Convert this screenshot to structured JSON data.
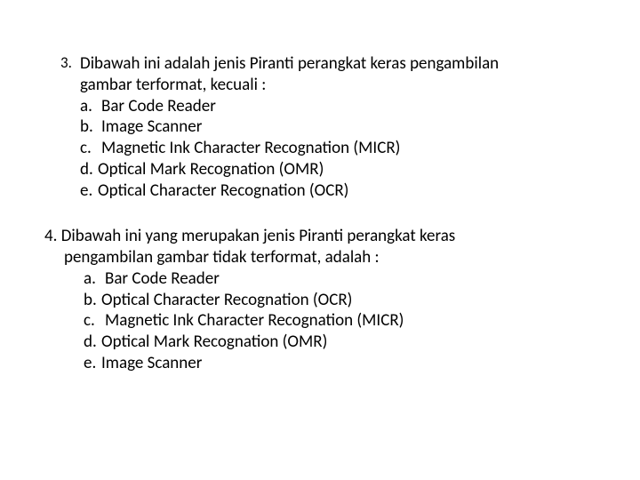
{
  "questions": [
    {
      "number": "3.",
      "text_line1": "Dibawah ini adalah jenis Piranti perangkat keras pengambilan",
      "text_line2": "gambar terformat, kecuali :",
      "options": [
        {
          "letter": "a.",
          "text": "Bar Code Reader",
          "tight": false
        },
        {
          "letter": "b.",
          "text": "Image Scanner",
          "tight": false
        },
        {
          "letter": "c.",
          "text": "Magnetic Ink Character Recognation (MICR)",
          "tight": false
        },
        {
          "letter": "d.",
          "text": "Optical Mark Recognation (OMR)",
          "tight": true
        },
        {
          "letter": "e.",
          "text": "Optical Character Recognation (OCR)",
          "tight": true
        }
      ]
    },
    {
      "number": "4.",
      "text_line1": "Dibawah ini yang merupakan jenis Piranti perangkat keras",
      "text_line2": "pengambilan gambar tidak terformat, adalah :",
      "options": [
        {
          "letter": "a.",
          "text": "Bar Code Reader",
          "tight": false
        },
        {
          "letter": "b.",
          "text": "Optical Character Recognation (OCR)",
          "tight": true
        },
        {
          "letter": "c.",
          "text": "Magnetic Ink Character Recognation (MICR)",
          "tight": false
        },
        {
          "letter": "d.",
          "text": "Optical Mark Recognation (OMR)",
          "tight": true
        },
        {
          "letter": "e.",
          "text": "Image Scanner",
          "tight": true
        }
      ]
    }
  ]
}
